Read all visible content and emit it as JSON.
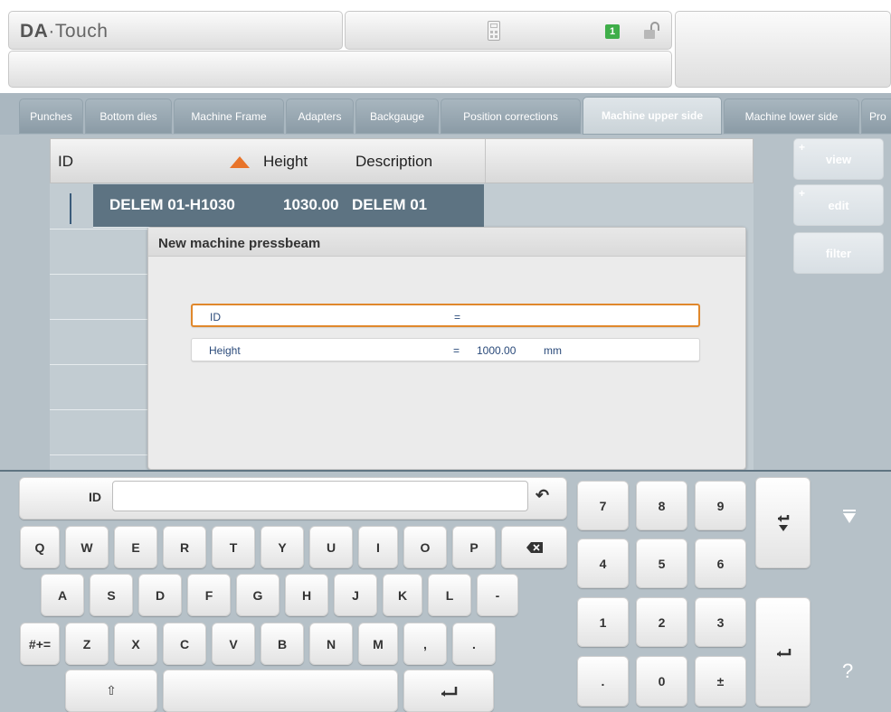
{
  "header": {
    "logo_bold": "DA",
    "logo_rest": "·Touch",
    "badge": "1",
    "calculator_icon": "calculator-icon",
    "lock_icon": "unlocked-padlock-icon"
  },
  "tabs": [
    {
      "label": "Punches",
      "active": false
    },
    {
      "label": "Bottom dies",
      "active": false
    },
    {
      "label": "Machine Frame",
      "active": false
    },
    {
      "label": "Adapters",
      "active": false
    },
    {
      "label": "Backgauge",
      "active": false
    },
    {
      "label": "Position corrections",
      "active": false
    },
    {
      "label": "Machine upper side",
      "active": true
    },
    {
      "label": "Machine lower side",
      "active": false
    },
    {
      "label": "Pro",
      "active": false
    }
  ],
  "table": {
    "columns": [
      "ID",
      "Height",
      "Description"
    ],
    "sort_column": "ID",
    "sort_direction": "ascending",
    "rows": [
      {
        "id": "DELEM 01-H1030",
        "height": "1030.00",
        "description": "DELEM 01",
        "selected": true
      }
    ]
  },
  "side_buttons": {
    "view": "view",
    "edit": "edit",
    "filter": "filter",
    "plus": "+"
  },
  "dialog": {
    "title": "New machine pressbeam",
    "fields": [
      {
        "label": "ID",
        "eq": "=",
        "value": "",
        "unit": "",
        "focused": true
      },
      {
        "label": "Height",
        "eq": "=",
        "value": "1000.00",
        "unit": "mm",
        "focused": false
      }
    ]
  },
  "keyboard": {
    "input_label": "ID",
    "input_value": "",
    "row1": [
      "Q",
      "W",
      "E",
      "R",
      "T",
      "Y",
      "U",
      "I",
      "O",
      "P"
    ],
    "row2": [
      "A",
      "S",
      "D",
      "F",
      "G",
      "H",
      "J",
      "K",
      "L",
      "-"
    ],
    "row3": [
      "#+=",
      "Z",
      "X",
      "C",
      "V",
      "B",
      "N",
      "M",
      ",",
      "."
    ],
    "shift_glyph": "⇧",
    "undo_glyph": "↶",
    "numpad": [
      "7",
      "8",
      "9",
      "4",
      "5",
      "6",
      "1",
      "2",
      "3",
      ".",
      "0",
      "±"
    ],
    "help": "?"
  },
  "colors": {
    "accent": "#e8742a",
    "selected_row": "#5d7382",
    "panel_bg": "#b6c1c8",
    "tab_bg": "#8b9ba6",
    "badge_green": "#3fae49"
  }
}
